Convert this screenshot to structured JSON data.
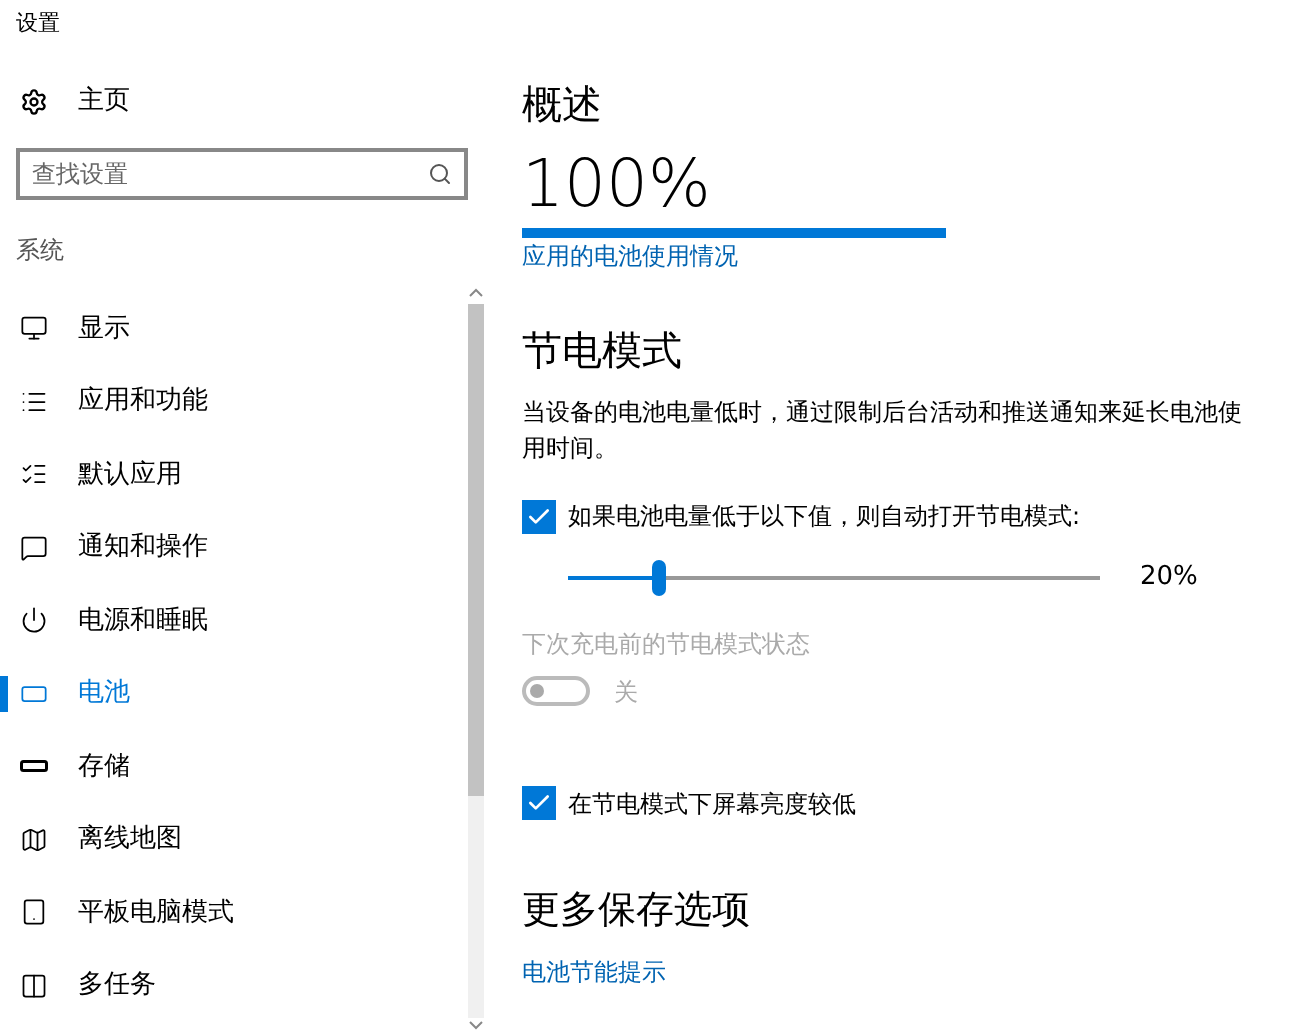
{
  "window": {
    "title": "设置"
  },
  "sidebar": {
    "home": "主页",
    "search": {
      "placeholder": "查找设置"
    },
    "section": "系统",
    "items": [
      {
        "label": "显示",
        "selected": false
      },
      {
        "label": "应用和功能",
        "selected": false
      },
      {
        "label": "默认应用",
        "selected": false
      },
      {
        "label": "通知和操作",
        "selected": false
      },
      {
        "label": "电源和睡眠",
        "selected": false
      },
      {
        "label": "电池",
        "selected": true
      },
      {
        "label": "存储",
        "selected": false
      },
      {
        "label": "离线地图",
        "selected": false
      },
      {
        "label": "平板电脑模式",
        "selected": false
      },
      {
        "label": "多任务",
        "selected": false
      }
    ]
  },
  "overview": {
    "heading": "概述",
    "percent": "100%",
    "level": 1,
    "link": "应用的电池使用情况"
  },
  "saver": {
    "heading": "节电模式",
    "description": "当设备的电池电量低时，通过限制后台活动和推送通知来延长电池使用时间。",
    "auto": {
      "label": "如果电池电量低于以下值，则自动打开节电模式:",
      "checked": true
    },
    "threshold": {
      "level": 0.17,
      "reading": "20%"
    },
    "status": {
      "label": "下次充电前的节电模式状态",
      "on": false,
      "disabled": true,
      "state_text": "关"
    },
    "brightness": {
      "label": "在节电模式下屏幕亮度较低",
      "checked": true
    }
  },
  "more": {
    "heading": "更多保存选项",
    "link": "电池节能提示"
  }
}
